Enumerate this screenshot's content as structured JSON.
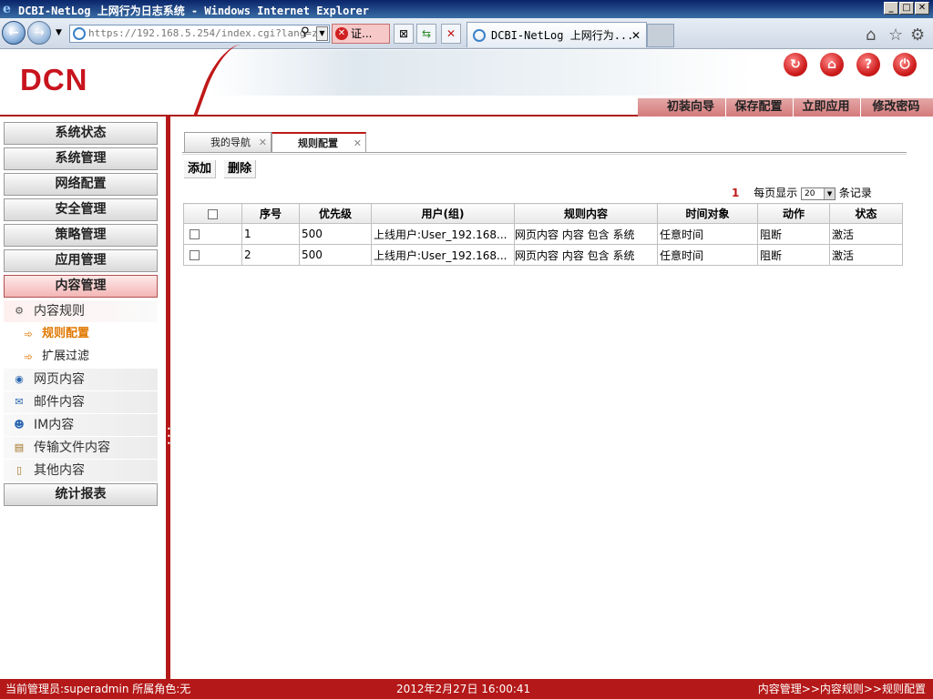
{
  "window": {
    "title": "DCBI-NetLog 上网行为日志系统 - Windows Internet Explorer",
    "min": "_",
    "max": "□",
    "close": "✕"
  },
  "browser": {
    "url": "https://192.168.5.254/index.cgi?lang=z",
    "cert_label": "证...",
    "tab_title": "DCBI-NetLog 上网行为...",
    "tab_close": "✕"
  },
  "header": {
    "logo": "DCN",
    "menu": [
      "初装向导",
      "保存配置",
      "立即应用",
      "修改密码"
    ]
  },
  "sidebar": {
    "top_items": [
      "系统状态",
      "系统管理",
      "网络配置",
      "安全管理",
      "策略管理",
      "应用管理",
      "内容管理"
    ],
    "sub_items": [
      "内容规则",
      "网页内容",
      "邮件内容",
      "IM内容",
      "传输文件内容",
      "其他内容"
    ],
    "rule_children": [
      "规则配置",
      "扩展过滤"
    ],
    "bottom_item": "统计报表"
  },
  "tabs": [
    "我的导航",
    "规则配置"
  ],
  "actions": {
    "add": "添加",
    "delete": "删除"
  },
  "pager": {
    "page": "1",
    "per_page_label": "每页显示",
    "per_page": "20",
    "records_label": "条记录"
  },
  "table": {
    "headers": [
      "序号",
      "优先级",
      "用户(组)",
      "规则内容",
      "时间对象",
      "动作",
      "状态"
    ],
    "rows": [
      [
        "1",
        "500",
        "上线用户:User_192.168...",
        "网页内容  内容  包含  系统",
        "任意时间",
        "阻断",
        "激活"
      ],
      [
        "2",
        "500",
        "上线用户:User_192.168...",
        "网页内容  内容  包含  系统",
        "任意时间",
        "阻断",
        "激活"
      ]
    ]
  },
  "status": {
    "admin": "当前管理员:superadmin  所属角色:无",
    "datetime": "2012年2月27日 16:00:41",
    "breadcrumb": "内容管理>>内容规则>>规则配置"
  }
}
